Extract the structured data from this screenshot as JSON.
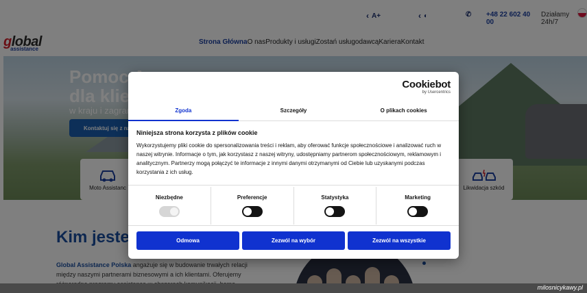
{
  "topbar": {
    "font_size_label": "A+",
    "phone": "+48 22 602 40 00",
    "hours": "Działamy 24h/7"
  },
  "logo": {
    "word": "global",
    "sub": "assistance"
  },
  "nav": {
    "items": [
      "Strona Główna",
      "O nas",
      "Produkty i usługi",
      "Zostań usługodawcą",
      "Kariera",
      "Kontakt"
    ]
  },
  "hero": {
    "title_line1": "Pomoc A",
    "title_line2": "dla klie",
    "subtitle": "w kraju i zagran",
    "cta": "Kontaktuj się z na",
    "cards": [
      "Moto Assistanc",
      "Likwidacja szkód"
    ]
  },
  "about": {
    "title": "Kim jesteś",
    "brand": "Global Assistance Polska",
    "text": "angażuje się w budowanie trwałych relacji między naszymi partnerami biznesowymi a ich klientami. Oferujemy różnorodne programy assistance w obszarach komunikacji, home assistance, assistance"
  },
  "cookie": {
    "brand": "Cookiebot",
    "brand_sub": "by Usercentrics",
    "tabs": [
      "Zgoda",
      "Szczegóły",
      "O plikach cookies"
    ],
    "heading": "Niniejsza strona korzysta z plików cookie",
    "body": "Wykorzystujemy pliki cookie do spersonalizowania treści i reklam, aby oferować funkcje społecznościowe i analizować ruch w naszej witrynie. Informacje o tym, jak korzystasz z naszej witryny, udostępniamy partnerom społecznościowym, reklamowym i analitycznym. Partnerzy mogą połączyć te informacje z innymi danymi otrzymanymi od Ciebie lub uzyskanymi podczas korzystania z ich usług.",
    "toggles": [
      {
        "label": "Niezbędne",
        "state": "on-disabled"
      },
      {
        "label": "Preferencje",
        "state": "off"
      },
      {
        "label": "Statystyka",
        "state": "off"
      },
      {
        "label": "Marketing",
        "state": "off"
      }
    ],
    "buttons": [
      "Odmowa",
      "Zezwól na wybór",
      "Zezwól na wszystkie"
    ],
    "accent_color": "#1032cf"
  },
  "watermark": "milosnicykawy.pl"
}
